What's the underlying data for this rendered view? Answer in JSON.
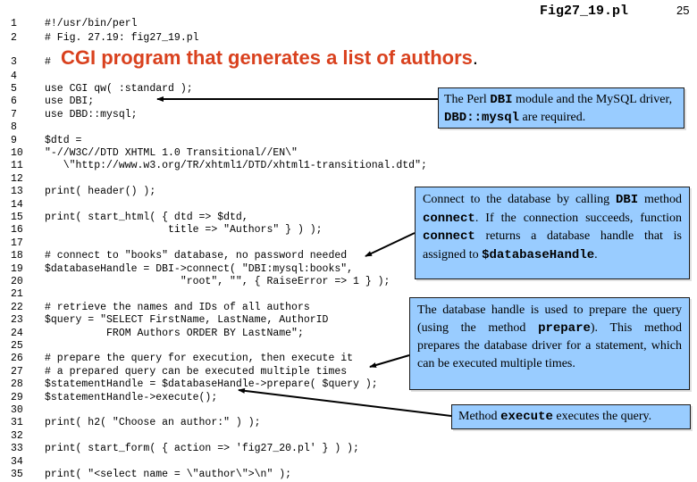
{
  "header": {
    "file_name": "Fig27_19.pl",
    "page_number": "25"
  },
  "title": {
    "prefix": "#",
    "text": "CGI program that generates a list of authors",
    "period": ".",
    "color": "#d9411e"
  },
  "code_lines": [
    {
      "n": "1",
      "text": "#!/usr/bin/perl"
    },
    {
      "n": "2",
      "text": "# Fig. 27.19: fig27_19.pl"
    },
    {
      "n": "3",
      "text": ""
    },
    {
      "n": "4",
      "text": ""
    },
    {
      "n": "5",
      "text": "use CGI qw( :standard );"
    },
    {
      "n": "6",
      "text": "use DBI;"
    },
    {
      "n": "7",
      "text": "use DBD::mysql;"
    },
    {
      "n": "8",
      "text": ""
    },
    {
      "n": "9",
      "text": "$dtd ="
    },
    {
      "n": "10",
      "text": "\"-//W3C//DTD XHTML 1.0 Transitional//EN\\\""
    },
    {
      "n": "11",
      "text": "   \\\"http://www.w3.org/TR/xhtml1/DTD/xhtml1-transitional.dtd\";"
    },
    {
      "n": "12",
      "text": ""
    },
    {
      "n": "13",
      "text": "print( header() );"
    },
    {
      "n": "14",
      "text": ""
    },
    {
      "n": "15",
      "text": "print( start_html( { dtd => $dtd,"
    },
    {
      "n": "16",
      "text": "                    title => \"Authors\" } ) );"
    },
    {
      "n": "17",
      "text": ""
    },
    {
      "n": "18",
      "text": "# connect to \"books\" database, no password needed"
    },
    {
      "n": "19",
      "text": "$databaseHandle = DBI->connect( \"DBI:mysql:books\","
    },
    {
      "n": "20",
      "text": "                      \"root\", \"\", { RaiseError => 1 } );"
    },
    {
      "n": "21",
      "text": ""
    },
    {
      "n": "22",
      "text": "# retrieve the names and IDs of all authors"
    },
    {
      "n": "23",
      "text": "$query = \"SELECT FirstName, LastName, AuthorID"
    },
    {
      "n": "24",
      "text": "          FROM Authors ORDER BY LastName\";"
    },
    {
      "n": "25",
      "text": ""
    },
    {
      "n": "26",
      "text": "# prepare the query for execution, then execute it"
    },
    {
      "n": "27",
      "text": "# a prepared query can be executed multiple times"
    },
    {
      "n": "28",
      "text": "$statementHandle = $databaseHandle->prepare( $query );"
    },
    {
      "n": "29",
      "text": "$statementHandle->execute();"
    },
    {
      "n": "30",
      "text": ""
    },
    {
      "n": "31",
      "text": "print( h2( \"Choose an author:\" ) );"
    },
    {
      "n": "32",
      "text": ""
    },
    {
      "n": "33",
      "text": "print( start_form( { action => 'fig27_20.pl' } ) );"
    },
    {
      "n": "34",
      "text": ""
    },
    {
      "n": "35",
      "text": "print( \"<select name = \\\"author\\\">\\n\" );"
    }
  ],
  "callouts": {
    "dbi_module": {
      "t1": "The Perl ",
      "c1": "DBI",
      "t2": " module and the MySQL driver, ",
      "c2": "DBD::mysql",
      "t3": " are required."
    },
    "connect": {
      "t1": "Connect to the database by calling ",
      "c1": "DBI",
      "t2": " method ",
      "c2": "connect",
      "t3": ". If the connection succeeds, function ",
      "c3": "connect",
      "t4": " returns a database handle that is assigned to ",
      "c4": "$databaseHandle",
      "t5": "."
    },
    "prepare": {
      "t1": "The database handle is used to prepare the query (using the method ",
      "c1": "prepare",
      "t2": "). This method prepares the database driver for a statement, which can be executed multiple times."
    },
    "execute": {
      "t1": "Method ",
      "c1": "execute",
      "t2": " executes the query."
    },
    "fill_color": "#99ccff"
  }
}
